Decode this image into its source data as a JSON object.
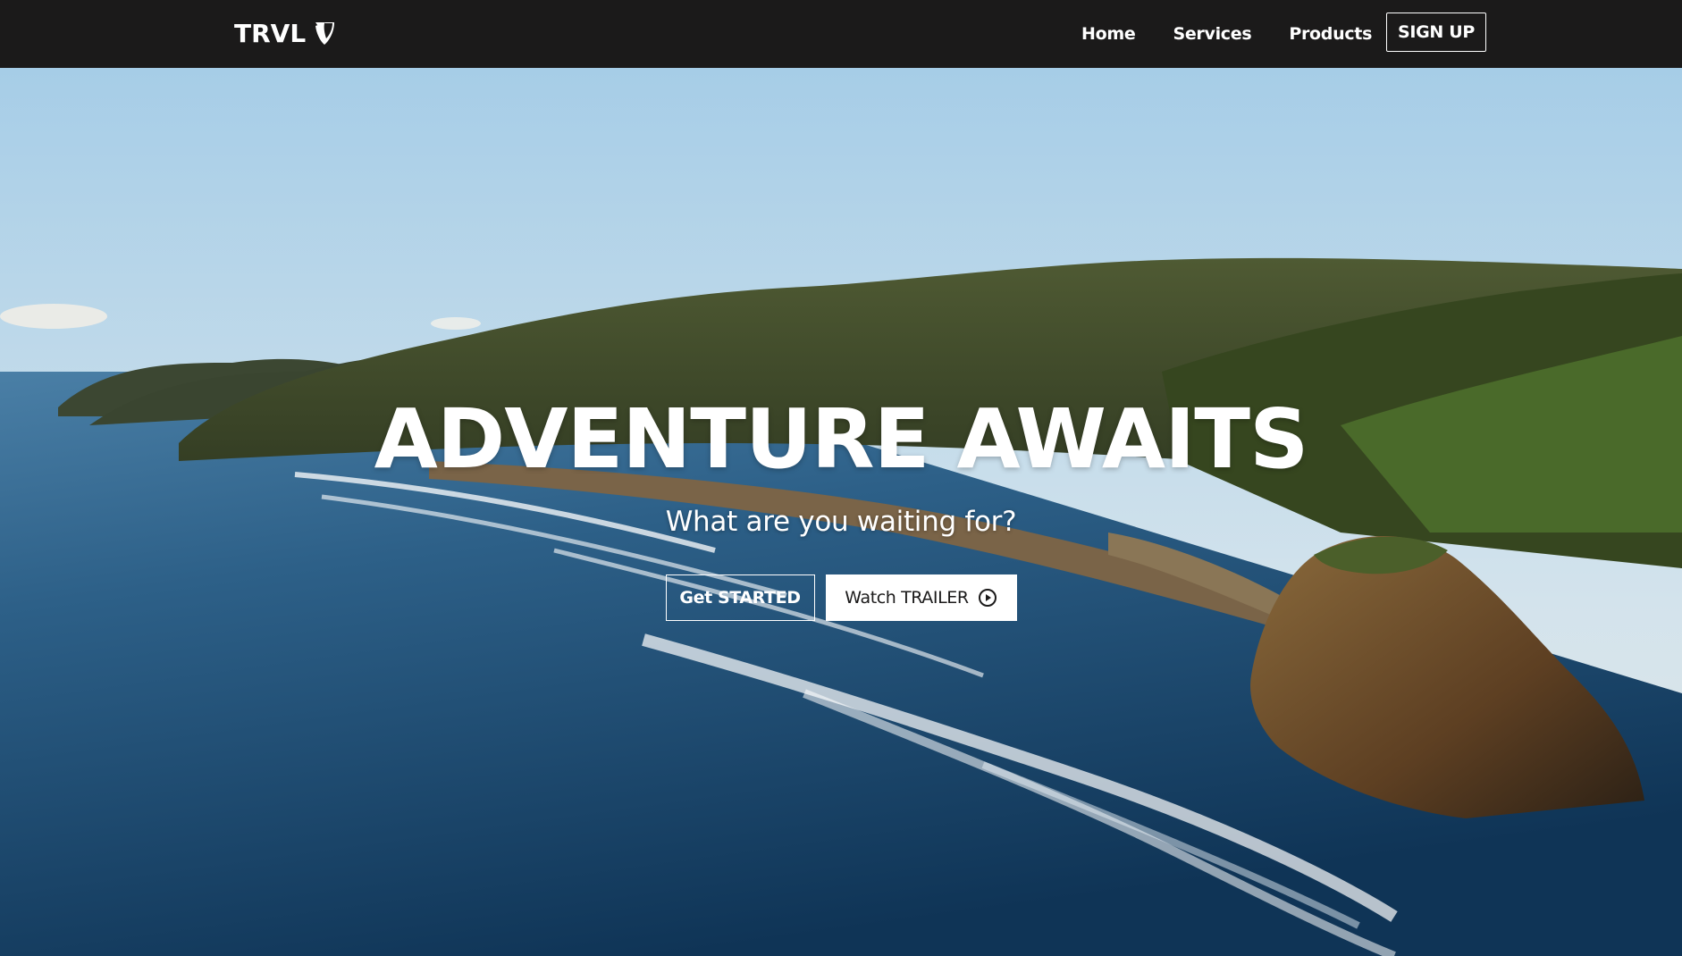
{
  "brand": {
    "name": "TRVL",
    "logo_icon": "typo3-icon"
  },
  "nav": {
    "items": [
      {
        "label": "Home"
      },
      {
        "label": "Services"
      },
      {
        "label": "Products"
      }
    ],
    "signup_label": "SIGN UP"
  },
  "hero": {
    "title": "ADVENTURE AWAITS",
    "subtitle": "What are you waiting for?",
    "primary_button": "Get STARTED",
    "secondary_button": "Watch TRAILER",
    "secondary_icon": "play-circle-icon"
  },
  "colors": {
    "navbar": "#1b1a1a",
    "text": "#ffffff",
    "sky": "#a9cfe6",
    "ocean": "#1e4a6e"
  }
}
